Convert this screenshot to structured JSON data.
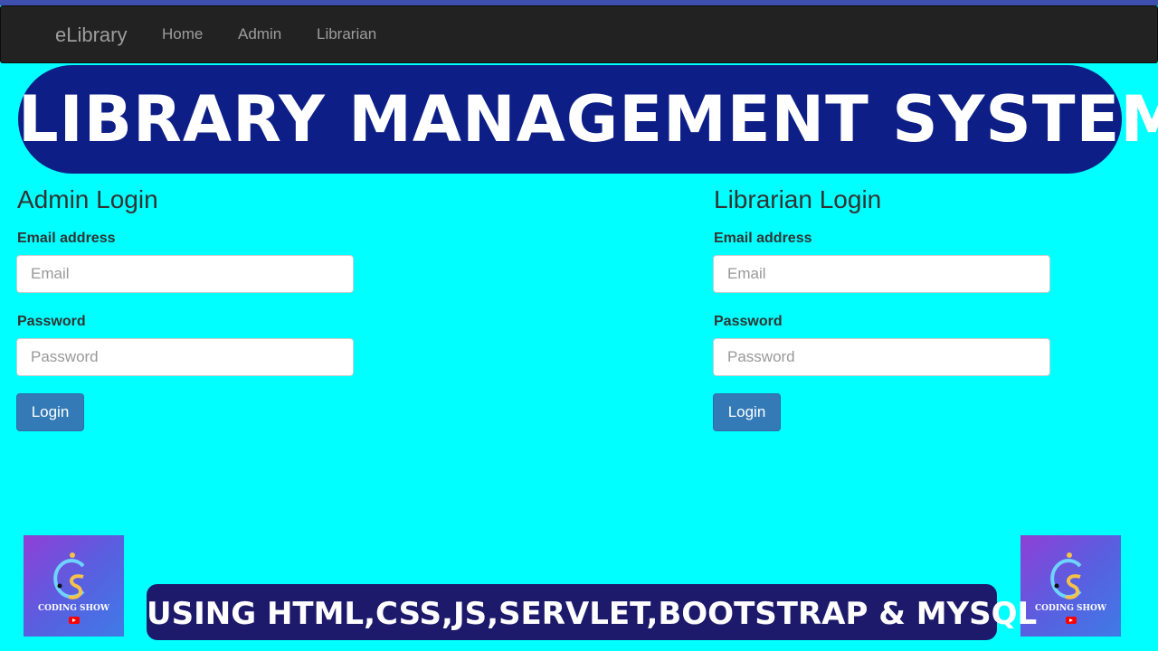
{
  "navbar": {
    "brand": "eLibrary",
    "links": [
      "Home",
      "Admin",
      "Librarian"
    ]
  },
  "banner": {
    "title": "LIBRARY MANAGEMENT SYSTEM"
  },
  "admin_panel": {
    "title": "Admin Login",
    "email_label": "Email address",
    "email_placeholder": "Email",
    "password_label": "Password",
    "password_placeholder": "Password",
    "login_label": "Login"
  },
  "librarian_panel": {
    "title": "Librarian Login",
    "email_label": "Email address",
    "email_placeholder": "Email",
    "password_label": "Password",
    "password_placeholder": "Password",
    "login_label": "Login"
  },
  "logo": {
    "name": "CODING SHOW",
    "icon": "youtube-icon"
  },
  "footer": {
    "text": "USING HTML,CSS,JS,SERVLET,BOOTSTRAP & MYSQL"
  },
  "colors": {
    "page_background": "#00ffff",
    "navbar": "#222222",
    "banner": "#0d1f87",
    "button": "#337ab7",
    "footer": "#1e1a6b"
  }
}
